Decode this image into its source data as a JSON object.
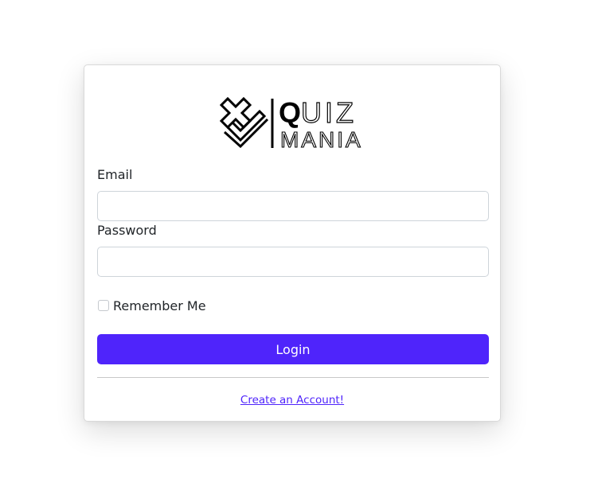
{
  "brand": {
    "word_top": "QUIZ",
    "word_bottom": "MANIA",
    "logo_icon": "x-check-mark-icon"
  },
  "form": {
    "email_label": "Email",
    "email_value": "",
    "email_placeholder": "",
    "password_label": "Password",
    "password_value": "",
    "password_placeholder": "",
    "remember_label": "Remember Me",
    "remember_checked": false,
    "login_label": "Login",
    "create_account_label": "Create an Account!"
  },
  "colors": {
    "accent": "#4f24fb",
    "logo": "#000000",
    "border": "#ced4da"
  }
}
